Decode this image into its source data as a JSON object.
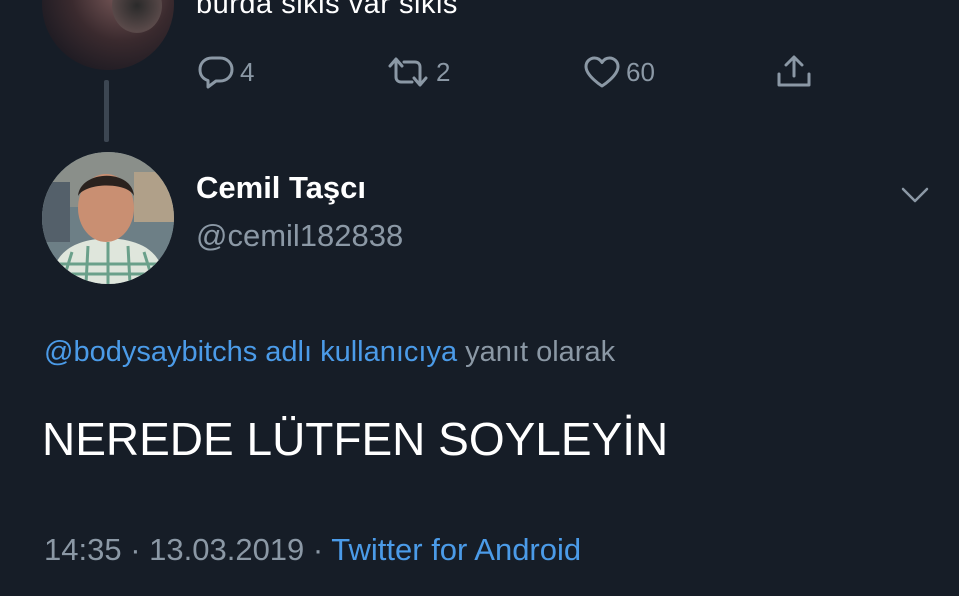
{
  "previous_tweet": {
    "text": "burda sikis var sikis",
    "actions": {
      "reply_count": "4",
      "retweet_count": "2",
      "like_count": "60"
    },
    "icons": [
      "reply-icon",
      "retweet-icon",
      "like-icon",
      "share-icon"
    ]
  },
  "tweet": {
    "author_name": "Cemil Taşcı",
    "author_handle": "@cemil182838",
    "reply_to_mention": "@bodysaybitchs adlı kullanıcıya",
    "reply_to_suffix": " yanıt olarak",
    "text": "NEREDE LÜTFEN SOYLEYİN",
    "time": "14:35",
    "separator": " · ",
    "date": "13.03.2019",
    "source": "Twitter for Android"
  },
  "colors": {
    "background": "#161d27",
    "link": "#4b9be8",
    "secondary_text": "#8b98a5",
    "primary_text": "#ffffff"
  }
}
